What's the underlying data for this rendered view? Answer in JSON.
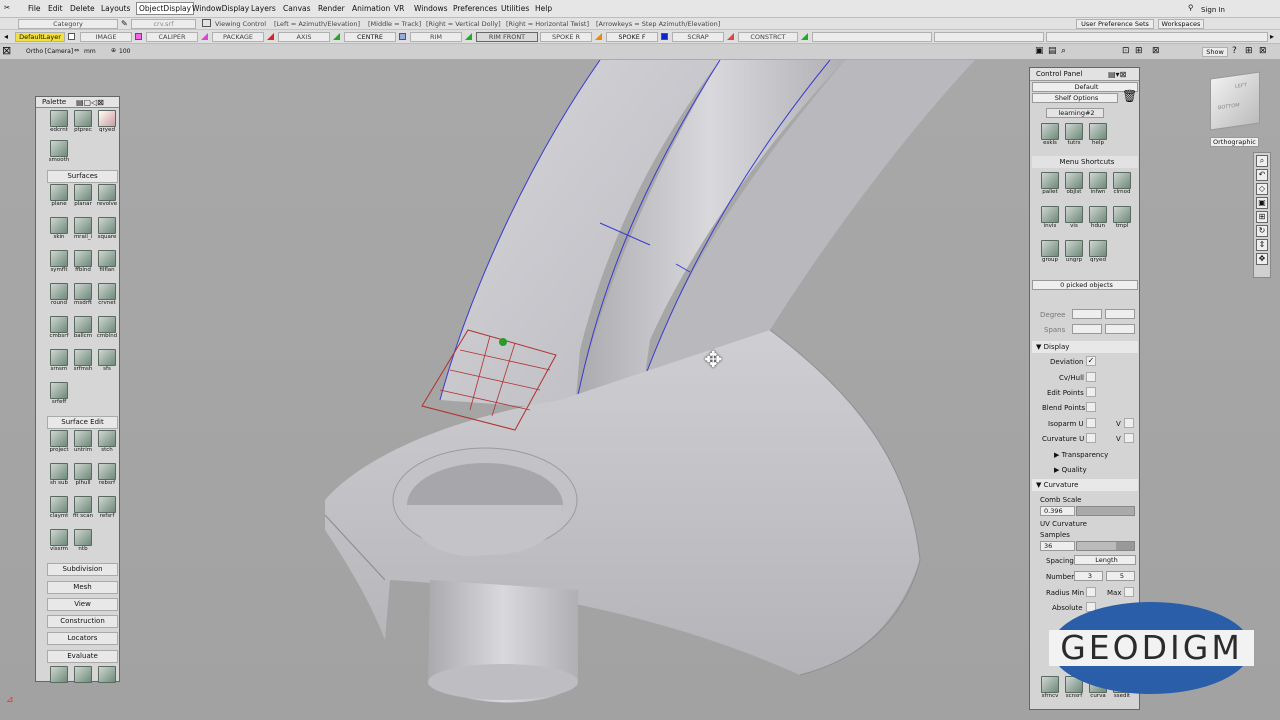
{
  "menubar": {
    "items": [
      "File",
      "Edit",
      "Delete",
      "Layouts",
      "ObjectDisplay",
      "WindowDisplay",
      "Layers",
      "Canvas",
      "Render",
      "Animation",
      "VR",
      "Windows",
      "Preferences",
      "Utilities",
      "Help"
    ],
    "sign_in": "Sign In"
  },
  "row2": {
    "category": "Category",
    "file": "crv.srf",
    "viewing_control": "Viewing Control",
    "left_hint": "[Left = Azimuth/Elevation]",
    "middle_hint": "[Middle = Track]",
    "right_hint": "[Right = Vertical Dolly]",
    "right2_hint": "[Right = Horizontal Twist]",
    "arrow_hint": "[Arrowkeys = Step Azimuth/Elevation]",
    "user_pref": "User Preference Sets",
    "workspaces": "Workspaces"
  },
  "layers": [
    "DefaultLayer",
    "IMAGE",
    "CALIPER",
    "PACKAGE",
    "AXIS",
    "CENTRE",
    "RIM",
    "RIM FRONT",
    "SPOKE R",
    "SPOKE F",
    "SCRAP",
    "CONSTRCT"
  ],
  "viewbar": {
    "camera": "Ortho [Camera]",
    "units": "mm",
    "zoom": "100",
    "show": "Show"
  },
  "palette": {
    "title": "Palette",
    "top_tools": [
      "edcrnt",
      "ptprec",
      "qryed",
      "smooth"
    ],
    "surfaces_label": "Surfaces",
    "surfaces": [
      "plane",
      "planar",
      "revolve",
      "skin",
      "mrail_i",
      "square",
      "symflt",
      "ffblnd",
      "filflan",
      "round",
      "msdrft",
      "crvnet",
      "cmbsrf",
      "ballcrn",
      "cmblnd",
      "srnsrn",
      "srfmsh",
      "sfs",
      "srfeff"
    ],
    "surface_edit_label": "Surface Edit",
    "surface_edit": [
      "project",
      "untrim",
      "stch",
      "sh sub",
      "plhull",
      "rebsrf",
      "claymt",
      "fit scan",
      "refsrf",
      "vissrm",
      "ntb"
    ],
    "sections": [
      "Subdivision",
      "Mesh",
      "View",
      "Construction",
      "Locators",
      "Evaluate"
    ]
  },
  "viewcube": {
    "label": "Orthographic",
    "faces": [
      "LEFT",
      "BOTTOM"
    ]
  },
  "control_panel": {
    "title": "Control Panel",
    "preset": "Default",
    "shelf_options": "Shelf Options",
    "shelf_tab": "learning#2",
    "shelf_tools": [
      "eskls",
      "tutrs",
      "help"
    ],
    "menu_shortcuts": "Menu Shortcuts",
    "shortcut_tools": [
      "pallet",
      "objlst",
      "infwn",
      "clrnod",
      "invis",
      "vis",
      "hdun",
      "tmpl",
      "group",
      "ungrp",
      "qryed"
    ],
    "picked": "0 picked objects",
    "degree": "Degree",
    "spans": "Spans",
    "display": "Display",
    "deviation": "Deviation",
    "cv_hull": "Cv/Hull",
    "edit_points": "Edit Points",
    "blend_points": "Blend Points",
    "isoparm_u": "Isoparm U",
    "curvature_u": "Curvature U",
    "v_label": "V",
    "transparency": "Transparency",
    "quality": "Quality",
    "curvature": "Curvature",
    "comb_scale": "Comb Scale",
    "comb_value": "0.396",
    "uv_curvature": "UV Curvature",
    "samples": "Samples",
    "samples_value": "36",
    "spacing": "Spacing",
    "spacing_value": "Length",
    "number": "Number",
    "number_a": "3",
    "number_b": "5",
    "radius_min": "Radius Min",
    "max": "Max",
    "absolute": "Absolute",
    "bottom_tools": [
      "sfrncv",
      "scnsrf",
      "curva",
      "ssedit"
    ]
  },
  "logo": {
    "text": "GEODIGM"
  },
  "colors": {
    "logo_blue": "#2a5ea8",
    "curve_blue": "#3a3ad0",
    "hull_red": "#b03030"
  }
}
